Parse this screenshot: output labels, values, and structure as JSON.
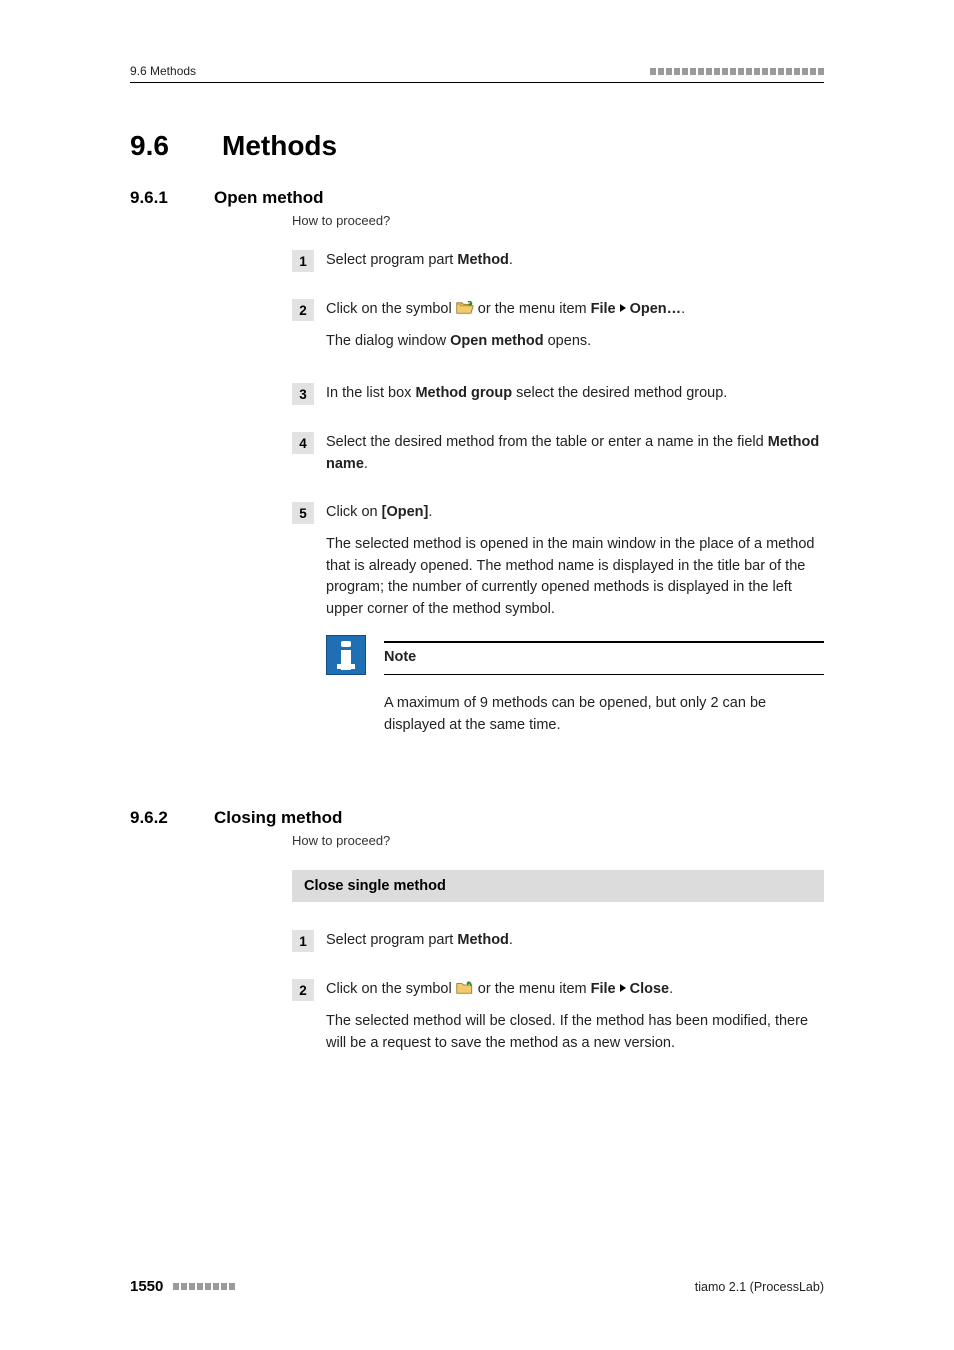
{
  "header": {
    "left": "9.6 Methods"
  },
  "h1": {
    "num": "9.6",
    "title": "Methods"
  },
  "sections": [
    {
      "num": "9.6.1",
      "title": "Open method",
      "howto": "How to proceed?",
      "steps": [
        {
          "n": "1",
          "parts": [
            "Select program part ",
            "Method",
            "."
          ]
        },
        {
          "n": "2",
          "parts": [
            "Click on the symbol ",
            "__ICON_OPEN__",
            " or the menu item ",
            "File",
            " ▸ ",
            "Open…",
            "."
          ],
          "after": "The dialog window Open method opens.",
          "after_bold": "Open method"
        },
        {
          "n": "3",
          "parts": [
            "In the list box ",
            "Method group",
            " select the desired method group."
          ]
        },
        {
          "n": "4",
          "parts": [
            "Select the desired method from the table or enter a name in the field ",
            "Method name",
            "."
          ]
        },
        {
          "n": "5",
          "parts": [
            "Click on ",
            "[Open]",
            "."
          ],
          "after_plain": "The selected method is opened in the main window in the place of a method that is already opened. The method name is displayed in the title bar of the program; the number of currently opened methods is displayed in the left upper corner of the method symbol.",
          "note": {
            "title": "Note",
            "text": "A maximum of 9 methods can be opened, but only 2 can be displayed at the same time."
          }
        }
      ]
    },
    {
      "num": "9.6.2",
      "title": "Closing method",
      "howto": "How to proceed?",
      "bar": "Close single method",
      "steps": [
        {
          "n": "1",
          "parts": [
            "Select program part ",
            "Method",
            "."
          ]
        },
        {
          "n": "2",
          "parts": [
            "Click on the symbol ",
            "__ICON_CLOSE__",
            " or the menu item ",
            "File",
            " ▸ ",
            "Close",
            "."
          ],
          "after_plain": "The selected method will be closed. If the method has been modified, there will be a request to save the method as a new version."
        }
      ]
    }
  ],
  "footer": {
    "page": "1550",
    "right": "tiamo 2.1 (ProcessLab)"
  }
}
